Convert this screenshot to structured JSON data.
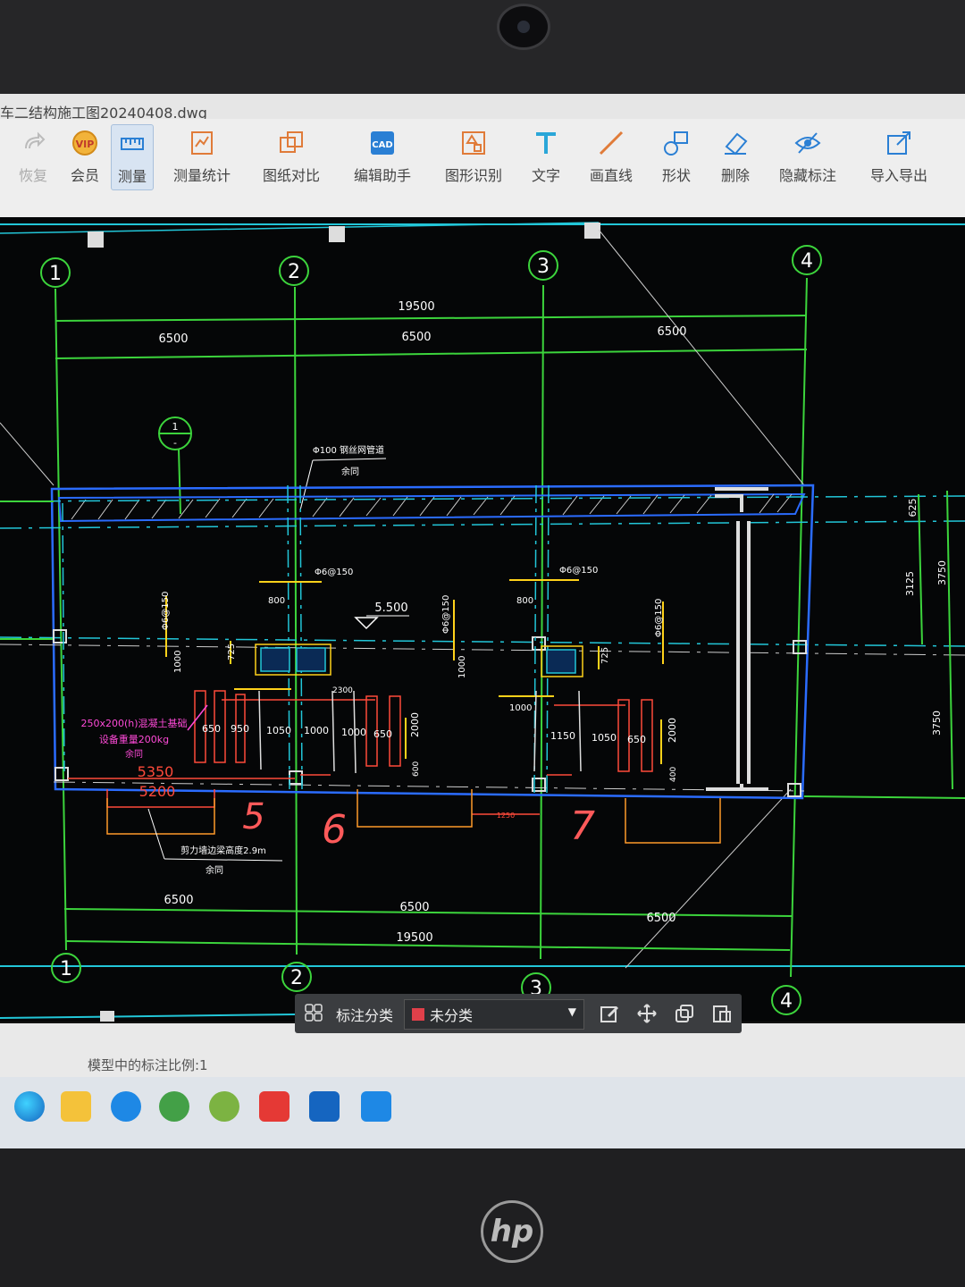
{
  "window": {
    "title": "车二结构施工图20240408.dwg"
  },
  "toolbar": {
    "items": [
      {
        "label": "恢复",
        "icon": "redo-icon"
      },
      {
        "label": "会员",
        "icon": "vip-icon"
      },
      {
        "label": "测量",
        "icon": "measure-icon"
      },
      {
        "label": "测量统计",
        "icon": "measure-stats-icon"
      },
      {
        "label": "图纸对比",
        "icon": "compare-icon"
      },
      {
        "label": "编辑助手",
        "icon": "edit-assistant-icon"
      },
      {
        "label": "图形识别",
        "icon": "shape-recognition-icon"
      },
      {
        "label": "文字",
        "icon": "text-icon"
      },
      {
        "label": "画直线",
        "icon": "line-icon"
      },
      {
        "label": "形状",
        "icon": "shape-icon"
      },
      {
        "label": "删除",
        "icon": "eraser-icon"
      },
      {
        "label": "隐藏标注",
        "icon": "eye-hide-icon"
      },
      {
        "label": "导入导出",
        "icon": "import-export-icon"
      }
    ]
  },
  "drawing": {
    "axis_labels_top": [
      "1",
      "2",
      "3",
      "4"
    ],
    "axis_labels_bottom": [
      "1",
      "2",
      "3",
      "4"
    ],
    "dims_top": {
      "total": "19500",
      "spans": [
        "6500",
        "6500",
        "6500"
      ]
    },
    "dims_bottom": {
      "total": "19500",
      "spans": [
        "6500",
        "6500",
        "6500"
      ]
    },
    "dims_right": [
      "625",
      "3125",
      "3750",
      "3750"
    ],
    "section_marker": {
      "top": "1",
      "bottom": "-"
    },
    "elevation": "5.500",
    "leader_note_top": [
      "Φ100 钢丝网管道",
      "余同"
    ],
    "leader_note_bottom": [
      "剪力墙边梁高度2.9m",
      "余同"
    ],
    "magenta_note": [
      "250x200(h)混凝土基础",
      "设备重量200kg",
      "余同"
    ],
    "rebar_labels": [
      "Φ6@150",
      "Φ6@150",
      "Φ6@150",
      "Φ6@150",
      "Φ6@150"
    ],
    "pit_dims": [
      "800",
      "800",
      "1000",
      "1000",
      "725",
      "725",
      "1000",
      "2300",
      "2000",
      "2000",
      "600",
      "400",
      "1050",
      "1000",
      "1000",
      "650",
      "650",
      "950",
      "1150",
      "1050",
      "650"
    ],
    "red_dims": [
      "5350",
      "5200",
      "1250"
    ],
    "handwritten": [
      "5",
      "6",
      "7"
    ]
  },
  "annotation_bar": {
    "label": "标注分类",
    "selected": "未分类"
  },
  "status": {
    "text": "模型中的标注比例:1"
  },
  "brand": {
    "logo_text": "hp"
  }
}
